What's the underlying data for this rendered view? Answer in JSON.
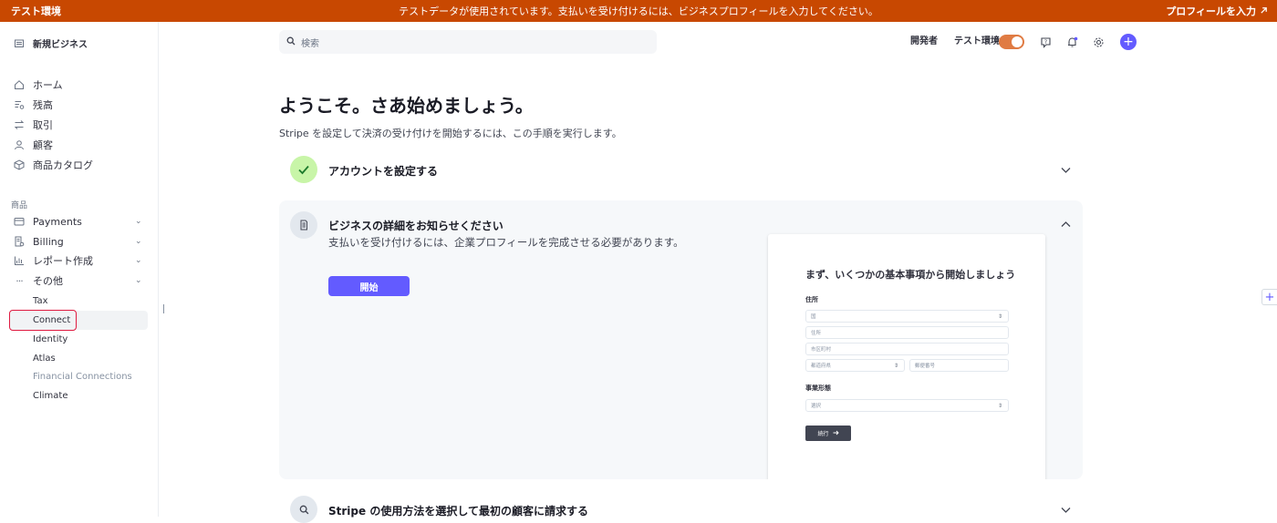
{
  "banner": {
    "env_label": "テスト環境",
    "message": "テストデータが使用されています。支払いを受け付けるには、ビジネスプロフィールを入力してください。",
    "link_label": "プロフィールを入力",
    "color": "#c84801"
  },
  "sidebar": {
    "account_name": "新規ビジネス",
    "main_items": [
      {
        "label": "ホーム",
        "icon": "home-icon"
      },
      {
        "label": "残高",
        "icon": "balance-icon"
      },
      {
        "label": "取引",
        "icon": "transactions-icon"
      },
      {
        "label": "顧客",
        "icon": "customer-icon"
      },
      {
        "label": "商品カタログ",
        "icon": "product-catalog-icon"
      }
    ],
    "section_label": "商品",
    "product_items": [
      {
        "label": "Payments",
        "icon": "payments-icon"
      },
      {
        "label": "Billing",
        "icon": "billing-icon"
      },
      {
        "label": "レポート作成",
        "icon": "reports-icon"
      },
      {
        "label": "その他",
        "icon": "more-icon"
      }
    ],
    "sub_items": [
      {
        "label": "Tax"
      },
      {
        "label": "Connect"
      },
      {
        "label": "Identity"
      },
      {
        "label": "Atlas"
      },
      {
        "label": "Financial Connections"
      },
      {
        "label": "Climate"
      }
    ],
    "active_item": "Connect"
  },
  "header": {
    "search_placeholder": "検索",
    "developer_label": "開発者",
    "test_env_label": "テスト環境",
    "test_env_on": true,
    "accent_color": "#635bff"
  },
  "main": {
    "title": "ようこそ。さあ始めましょう。",
    "subtitle": "Stripe を設定して決済の受け付けを開始するには、この手順を実行します。",
    "steps": [
      {
        "title": "アカウントを設定する",
        "status": "completed"
      },
      {
        "title": "ビジネスの詳細をお知らせください",
        "status": "expanded",
        "description": "支払いを受け付けるには、企業プロフィールを完成させる必要があります。",
        "button_label": "開始"
      },
      {
        "title": "Stripe の使用方法を選択して最初の顧客に請求する",
        "status": "collapsed"
      }
    ]
  },
  "preview_form": {
    "title": "まず、いくつかの基本事項から開始しましょう",
    "address_label": "住所",
    "country_placeholder": "国",
    "address_placeholder": "住所",
    "city_placeholder": "市区町村",
    "prefecture_placeholder": "都道府県",
    "postal_placeholder": "郵便番号",
    "business_type_label": "事業形態",
    "business_type_placeholder": "選択",
    "continue_label": "続行"
  }
}
